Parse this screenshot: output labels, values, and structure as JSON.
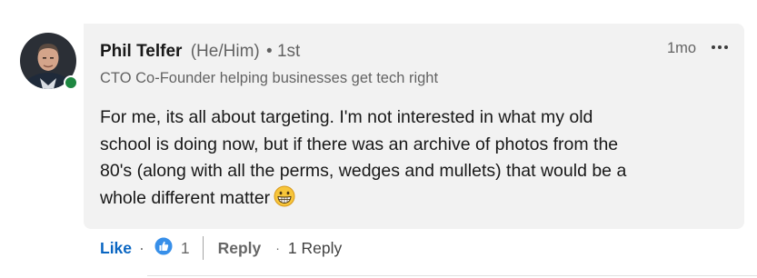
{
  "comment": {
    "author": {
      "name": "Phil Telfer",
      "pronouns": "(He/Him)",
      "degree": "• 1st",
      "headline": "CTO Co-Founder helping businesses get tech right",
      "online_status": "online",
      "presence_color": "#1e8741"
    },
    "timestamp": "1mo",
    "more_icon": "more-horizontal-icon",
    "body_lines": [
      "For me, its all about targeting. I'm not interested in what my old",
      "school is doing now, but if there was an archive of photos from the",
      "80's (along with all the perms, wedges and mullets) that would be a",
      "whole different matter"
    ],
    "emoji": "grinning-face-emoji"
  },
  "actions": {
    "like_label": "Like",
    "dot": "·",
    "reaction_icon": "like-reaction-icon",
    "reaction_count": "1",
    "reply_label": "Reply",
    "replies_label": "1 Reply"
  },
  "colors": {
    "bubble_bg": "#f2f2f2",
    "link_blue": "#0a66c2"
  }
}
